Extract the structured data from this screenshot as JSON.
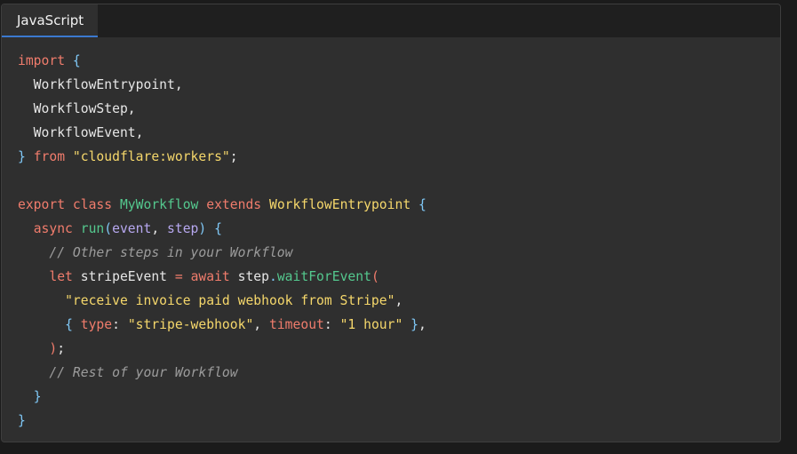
{
  "tab": {
    "label": "JavaScript"
  },
  "colors": {
    "keyword": "#f07c6c",
    "function": "#54c88e",
    "class": "#f5d76b",
    "string": "#f5d76b",
    "param": "#b7a8f0",
    "punctuation": "#7fc7f5",
    "comment": "#9c9c9c",
    "plain": "#e6e6e6",
    "tab_underline": "#3b79d0"
  },
  "code_lines": [
    [
      {
        "t": "import",
        "c": "kw"
      },
      {
        "t": " ",
        "c": "pl"
      },
      {
        "t": "{",
        "c": "pun"
      }
    ],
    [
      {
        "t": "  WorkflowEntrypoint,",
        "c": "pl"
      }
    ],
    [
      {
        "t": "  WorkflowStep,",
        "c": "pl"
      }
    ],
    [
      {
        "t": "  WorkflowEvent,",
        "c": "pl"
      }
    ],
    [
      {
        "t": "}",
        "c": "pun"
      },
      {
        "t": " ",
        "c": "pl"
      },
      {
        "t": "from",
        "c": "kw"
      },
      {
        "t": " ",
        "c": "pl"
      },
      {
        "t": "\"cloudflare:workers\"",
        "c": "str"
      },
      {
        "t": ";",
        "c": "pl"
      }
    ],
    [],
    [
      {
        "t": "export",
        "c": "kw"
      },
      {
        "t": " ",
        "c": "pl"
      },
      {
        "t": "class",
        "c": "kw"
      },
      {
        "t": " ",
        "c": "pl"
      },
      {
        "t": "MyWorkflow",
        "c": "fn"
      },
      {
        "t": " ",
        "c": "pl"
      },
      {
        "t": "extends",
        "c": "kw"
      },
      {
        "t": " ",
        "c": "pl"
      },
      {
        "t": "WorkflowEntrypoint",
        "c": "cls"
      },
      {
        "t": " ",
        "c": "pl"
      },
      {
        "t": "{",
        "c": "pun"
      }
    ],
    [
      {
        "t": "  ",
        "c": "pl"
      },
      {
        "t": "async",
        "c": "kw"
      },
      {
        "t": " ",
        "c": "pl"
      },
      {
        "t": "run",
        "c": "fn"
      },
      {
        "t": "(",
        "c": "pun"
      },
      {
        "t": "event",
        "c": "prm"
      },
      {
        "t": ", ",
        "c": "pl"
      },
      {
        "t": "step",
        "c": "prm"
      },
      {
        "t": ")",
        "c": "pun"
      },
      {
        "t": " ",
        "c": "pl"
      },
      {
        "t": "{",
        "c": "pun"
      }
    ],
    [
      {
        "t": "    // Other steps in your Workflow",
        "c": "cmt"
      }
    ],
    [
      {
        "t": "    ",
        "c": "pl"
      },
      {
        "t": "let",
        "c": "kw"
      },
      {
        "t": " stripeEvent ",
        "c": "pl"
      },
      {
        "t": "=",
        "c": "kw"
      },
      {
        "t": " ",
        "c": "pl"
      },
      {
        "t": "await",
        "c": "kw"
      },
      {
        "t": " step",
        "c": "pl"
      },
      {
        "t": ".",
        "c": "pun"
      },
      {
        "t": "waitForEvent",
        "c": "fn"
      },
      {
        "t": "(",
        "c": "kw"
      }
    ],
    [
      {
        "t": "      ",
        "c": "pl"
      },
      {
        "t": "\"receive invoice paid webhook from Stripe\"",
        "c": "str"
      },
      {
        "t": ",",
        "c": "pl"
      }
    ],
    [
      {
        "t": "      ",
        "c": "pl"
      },
      {
        "t": "{",
        "c": "pun"
      },
      {
        "t": " ",
        "c": "pl"
      },
      {
        "t": "type",
        "c": "kw"
      },
      {
        "t": ": ",
        "c": "pl"
      },
      {
        "t": "\"stripe-webhook\"",
        "c": "str"
      },
      {
        "t": ", ",
        "c": "pl"
      },
      {
        "t": "timeout",
        "c": "kw"
      },
      {
        "t": ": ",
        "c": "pl"
      },
      {
        "t": "\"1 hour\"",
        "c": "str"
      },
      {
        "t": " ",
        "c": "pl"
      },
      {
        "t": "}",
        "c": "pun"
      },
      {
        "t": ",",
        "c": "pl"
      }
    ],
    [
      {
        "t": "    ",
        "c": "pl"
      },
      {
        "t": ")",
        "c": "kw"
      },
      {
        "t": ";",
        "c": "pl"
      }
    ],
    [
      {
        "t": "    // Rest of your Workflow",
        "c": "cmt"
      }
    ],
    [
      {
        "t": "  ",
        "c": "pl"
      },
      {
        "t": "}",
        "c": "pun"
      }
    ],
    [
      {
        "t": "}",
        "c": "pun"
      }
    ]
  ]
}
